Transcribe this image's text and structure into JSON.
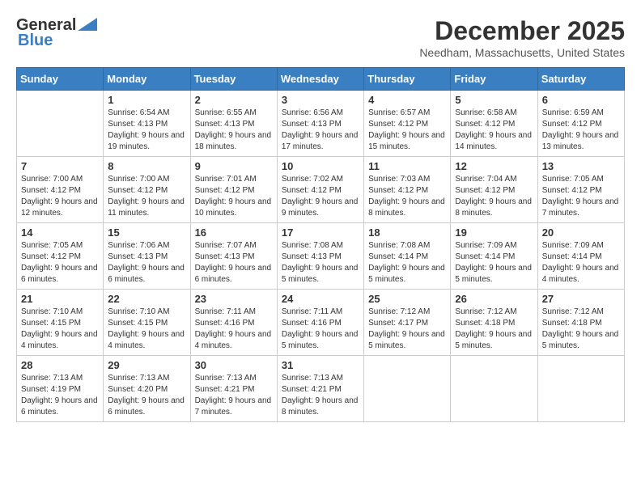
{
  "header": {
    "logo_general": "General",
    "logo_blue": "Blue",
    "title": "December 2025",
    "subtitle": "Needham, Massachusetts, United States"
  },
  "days": [
    "Sunday",
    "Monday",
    "Tuesday",
    "Wednesday",
    "Thursday",
    "Friday",
    "Saturday"
  ],
  "weeks": [
    [
      {
        "num": "",
        "sunrise": "",
        "sunset": "",
        "daylight": ""
      },
      {
        "num": "1",
        "sunrise": "Sunrise: 6:54 AM",
        "sunset": "Sunset: 4:13 PM",
        "daylight": "Daylight: 9 hours and 19 minutes."
      },
      {
        "num": "2",
        "sunrise": "Sunrise: 6:55 AM",
        "sunset": "Sunset: 4:13 PM",
        "daylight": "Daylight: 9 hours and 18 minutes."
      },
      {
        "num": "3",
        "sunrise": "Sunrise: 6:56 AM",
        "sunset": "Sunset: 4:13 PM",
        "daylight": "Daylight: 9 hours and 17 minutes."
      },
      {
        "num": "4",
        "sunrise": "Sunrise: 6:57 AM",
        "sunset": "Sunset: 4:12 PM",
        "daylight": "Daylight: 9 hours and 15 minutes."
      },
      {
        "num": "5",
        "sunrise": "Sunrise: 6:58 AM",
        "sunset": "Sunset: 4:12 PM",
        "daylight": "Daylight: 9 hours and 14 minutes."
      },
      {
        "num": "6",
        "sunrise": "Sunrise: 6:59 AM",
        "sunset": "Sunset: 4:12 PM",
        "daylight": "Daylight: 9 hours and 13 minutes."
      }
    ],
    [
      {
        "num": "7",
        "sunrise": "Sunrise: 7:00 AM",
        "sunset": "Sunset: 4:12 PM",
        "daylight": "Daylight: 9 hours and 12 minutes."
      },
      {
        "num": "8",
        "sunrise": "Sunrise: 7:00 AM",
        "sunset": "Sunset: 4:12 PM",
        "daylight": "Daylight: 9 hours and 11 minutes."
      },
      {
        "num": "9",
        "sunrise": "Sunrise: 7:01 AM",
        "sunset": "Sunset: 4:12 PM",
        "daylight": "Daylight: 9 hours and 10 minutes."
      },
      {
        "num": "10",
        "sunrise": "Sunrise: 7:02 AM",
        "sunset": "Sunset: 4:12 PM",
        "daylight": "Daylight: 9 hours and 9 minutes."
      },
      {
        "num": "11",
        "sunrise": "Sunrise: 7:03 AM",
        "sunset": "Sunset: 4:12 PM",
        "daylight": "Daylight: 9 hours and 8 minutes."
      },
      {
        "num": "12",
        "sunrise": "Sunrise: 7:04 AM",
        "sunset": "Sunset: 4:12 PM",
        "daylight": "Daylight: 9 hours and 8 minutes."
      },
      {
        "num": "13",
        "sunrise": "Sunrise: 7:05 AM",
        "sunset": "Sunset: 4:12 PM",
        "daylight": "Daylight: 9 hours and 7 minutes."
      }
    ],
    [
      {
        "num": "14",
        "sunrise": "Sunrise: 7:05 AM",
        "sunset": "Sunset: 4:12 PM",
        "daylight": "Daylight: 9 hours and 6 minutes."
      },
      {
        "num": "15",
        "sunrise": "Sunrise: 7:06 AM",
        "sunset": "Sunset: 4:13 PM",
        "daylight": "Daylight: 9 hours and 6 minutes."
      },
      {
        "num": "16",
        "sunrise": "Sunrise: 7:07 AM",
        "sunset": "Sunset: 4:13 PM",
        "daylight": "Daylight: 9 hours and 6 minutes."
      },
      {
        "num": "17",
        "sunrise": "Sunrise: 7:08 AM",
        "sunset": "Sunset: 4:13 PM",
        "daylight": "Daylight: 9 hours and 5 minutes."
      },
      {
        "num": "18",
        "sunrise": "Sunrise: 7:08 AM",
        "sunset": "Sunset: 4:14 PM",
        "daylight": "Daylight: 9 hours and 5 minutes."
      },
      {
        "num": "19",
        "sunrise": "Sunrise: 7:09 AM",
        "sunset": "Sunset: 4:14 PM",
        "daylight": "Daylight: 9 hours and 5 minutes."
      },
      {
        "num": "20",
        "sunrise": "Sunrise: 7:09 AM",
        "sunset": "Sunset: 4:14 PM",
        "daylight": "Daylight: 9 hours and 4 minutes."
      }
    ],
    [
      {
        "num": "21",
        "sunrise": "Sunrise: 7:10 AM",
        "sunset": "Sunset: 4:15 PM",
        "daylight": "Daylight: 9 hours and 4 minutes."
      },
      {
        "num": "22",
        "sunrise": "Sunrise: 7:10 AM",
        "sunset": "Sunset: 4:15 PM",
        "daylight": "Daylight: 9 hours and 4 minutes."
      },
      {
        "num": "23",
        "sunrise": "Sunrise: 7:11 AM",
        "sunset": "Sunset: 4:16 PM",
        "daylight": "Daylight: 9 hours and 4 minutes."
      },
      {
        "num": "24",
        "sunrise": "Sunrise: 7:11 AM",
        "sunset": "Sunset: 4:16 PM",
        "daylight": "Daylight: 9 hours and 5 minutes."
      },
      {
        "num": "25",
        "sunrise": "Sunrise: 7:12 AM",
        "sunset": "Sunset: 4:17 PM",
        "daylight": "Daylight: 9 hours and 5 minutes."
      },
      {
        "num": "26",
        "sunrise": "Sunrise: 7:12 AM",
        "sunset": "Sunset: 4:18 PM",
        "daylight": "Daylight: 9 hours and 5 minutes."
      },
      {
        "num": "27",
        "sunrise": "Sunrise: 7:12 AM",
        "sunset": "Sunset: 4:18 PM",
        "daylight": "Daylight: 9 hours and 5 minutes."
      }
    ],
    [
      {
        "num": "28",
        "sunrise": "Sunrise: 7:13 AM",
        "sunset": "Sunset: 4:19 PM",
        "daylight": "Daylight: 9 hours and 6 minutes."
      },
      {
        "num": "29",
        "sunrise": "Sunrise: 7:13 AM",
        "sunset": "Sunset: 4:20 PM",
        "daylight": "Daylight: 9 hours and 6 minutes."
      },
      {
        "num": "30",
        "sunrise": "Sunrise: 7:13 AM",
        "sunset": "Sunset: 4:21 PM",
        "daylight": "Daylight: 9 hours and 7 minutes."
      },
      {
        "num": "31",
        "sunrise": "Sunrise: 7:13 AM",
        "sunset": "Sunset: 4:21 PM",
        "daylight": "Daylight: 9 hours and 8 minutes."
      },
      {
        "num": "",
        "sunrise": "",
        "sunset": "",
        "daylight": ""
      },
      {
        "num": "",
        "sunrise": "",
        "sunset": "",
        "daylight": ""
      },
      {
        "num": "",
        "sunrise": "",
        "sunset": "",
        "daylight": ""
      }
    ]
  ]
}
